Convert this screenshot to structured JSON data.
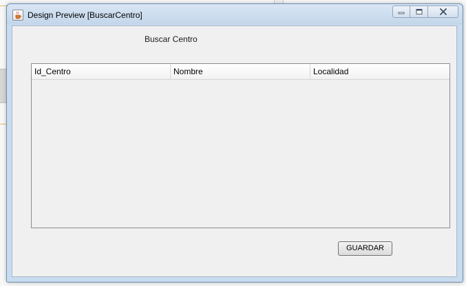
{
  "window": {
    "title": "Design Preview [BuscarCentro]"
  },
  "form": {
    "title": "Buscar Centro"
  },
  "table": {
    "columns": [
      "Id_Centro",
      "Nombre",
      "Localidad"
    ],
    "rows": []
  },
  "buttons": {
    "save_label": "GUARDAR"
  },
  "icons": {
    "app": "java-cup-icon",
    "minimize": "minimize-icon",
    "maximize": "maximize-icon",
    "close": "close-icon"
  },
  "colors": {
    "titlebar": "#c9dbee",
    "content_bg": "#f0f0f0",
    "table_border": "#8c8c8c"
  }
}
